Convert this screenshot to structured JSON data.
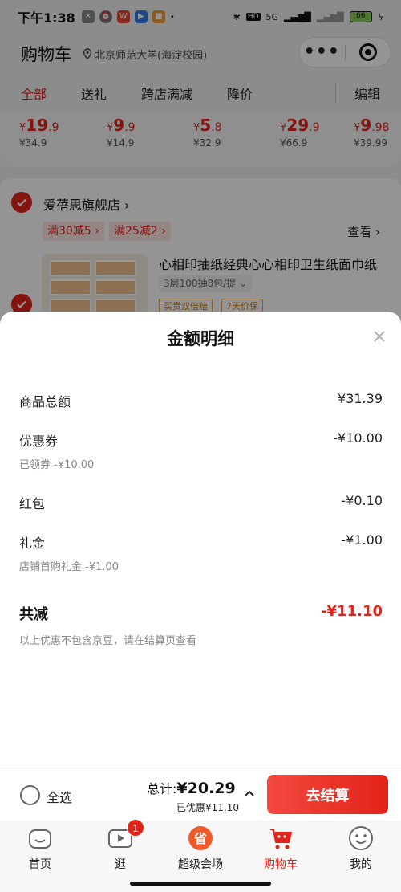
{
  "status_bar": {
    "time": "下午1:38",
    "network": "5G",
    "battery": "66"
  },
  "header": {
    "title": "购物车",
    "location": "北京师范大学(海淀校园)"
  },
  "tabs": [
    {
      "label": "全部",
      "active": true
    },
    {
      "label": "送礼"
    },
    {
      "label": "跨店满减"
    },
    {
      "label": "降价"
    },
    {
      "label": "编辑"
    }
  ],
  "price_strip": [
    {
      "int": "19",
      "dec": ".9",
      "orig": "¥34.9"
    },
    {
      "int": "9",
      "dec": ".9",
      "orig": "¥14.9"
    },
    {
      "int": "5",
      "dec": ".8",
      "orig": "¥32.9"
    },
    {
      "int": "29",
      "dec": ".9",
      "orig": "¥66.9"
    },
    {
      "int": "9",
      "dec": ".98",
      "orig": "¥39.99"
    }
  ],
  "currency": "¥",
  "store": {
    "name": "爱蓓思旗舰店",
    "promos": [
      "满30减5",
      "满25减2"
    ],
    "view_label": "查看",
    "product": {
      "title": "心相印抽纸经典心心相印卫生纸面巾纸",
      "spec": "3层100抽8包/提",
      "tags": [
        "买贵双倍赔",
        "7天价保"
      ]
    }
  },
  "sheet": {
    "title": "金额明细",
    "rows": [
      {
        "label": "商品总额",
        "value": "¥31.39"
      },
      {
        "label": "优惠券",
        "value": "-¥10.00",
        "sub": "已领券 -¥10.00"
      },
      {
        "label": "红包",
        "value": "-¥0.10"
      },
      {
        "label": "礼金",
        "value": "-¥1.00",
        "sub": "店铺首购礼金 -¥1.00"
      }
    ],
    "total_label": "共减",
    "total_value": "-¥11.10",
    "note": "以上优惠不包含京豆，请在结算页查看"
  },
  "bottom": {
    "select_all": "全选",
    "sum_label": "总计:",
    "sum_value": "¥20.29",
    "saved": "已优惠¥11.10",
    "checkout": "去结算"
  },
  "nav": [
    {
      "label": "首页"
    },
    {
      "label": "逛",
      "badge": "1"
    },
    {
      "label": "超级会场"
    },
    {
      "label": "购物车",
      "active": true
    },
    {
      "label": "我的"
    }
  ],
  "colors": {
    "accent": "#e2231a",
    "overlay": "rgba(0,0,0,0.42)"
  }
}
